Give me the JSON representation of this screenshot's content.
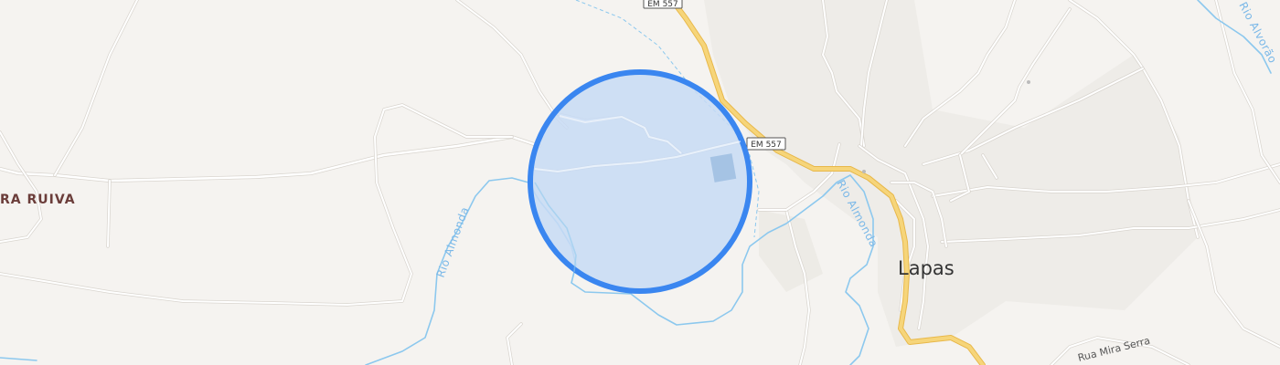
{
  "map": {
    "colors": {
      "land": "#f5f3f0",
      "urban": "#ebe8e4",
      "road_minor": "#ffffff",
      "road_major": "#f6d57a",
      "road_major_casing": "#e8b84a",
      "water": "#8cc8ee",
      "accent": "#3a86f0",
      "accent_fill": "#c7dbf5"
    },
    "places": [
      {
        "id": "lapas",
        "name": "Lapas",
        "color": "#333333"
      },
      {
        "id": "ruiva",
        "name": "RA RUIVA",
        "color": "#6b3d3a"
      }
    ],
    "road_shields": [
      {
        "id": "em557-top",
        "label": "EM 557"
      },
      {
        "id": "em557-mid",
        "label": "EM 557"
      }
    ],
    "rivers": [
      {
        "id": "almonda-west",
        "label": "Rio Almonda"
      },
      {
        "id": "almonda-east",
        "label": "Rio Almonda"
      },
      {
        "id": "alvorao",
        "label": "Rio Alvorão"
      }
    ],
    "streets": [
      {
        "id": "mira-serra",
        "label": "Rua Mira Serra"
      }
    ],
    "selection": {
      "shape": "circle",
      "stroke": "#3a86f0",
      "fill": "#c7dbf5"
    }
  }
}
